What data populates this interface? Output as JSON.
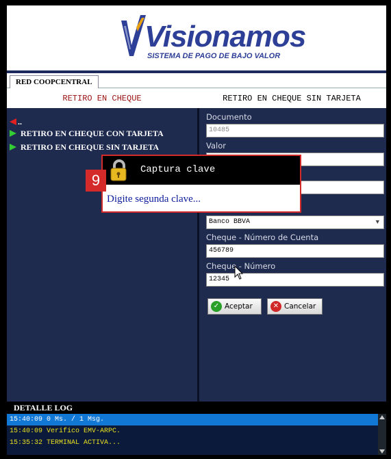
{
  "logo": {
    "brand": "Visionamos",
    "tagline": "SISTEMA DE PAGO DE BAJO VALOR"
  },
  "tab": {
    "label": "RED COOPCENTRAL"
  },
  "titles": {
    "left": "RETIRO EN CHEQUE",
    "right": "RETIRO EN CHEQUE SIN TARJETA"
  },
  "menu": {
    "back_label": "..",
    "items": [
      {
        "label": "RETIRO EN CHEQUE CON TARJETA"
      },
      {
        "label": "RETIRO EN CHEQUE SIN TARJETA"
      }
    ]
  },
  "form": {
    "documento_label": "Documento",
    "documento_value": "10485",
    "valor_label": "Valor",
    "valor_value": "",
    "field3_value": "",
    "bank_value": "Banco BBVA",
    "cuenta_label": "Cheque - Número de Cuenta",
    "cuenta_value": "456789",
    "numero_label": "Cheque - Número",
    "numero_value": "12345",
    "accept_label": "Aceptar",
    "cancel_label": "Cancelar"
  },
  "log": {
    "header": "DETALLE LOG",
    "lines": [
      "15:40:09 0 Ms. / 1 Msg.",
      "15:40:09 Verifico EMV-ARPC.",
      "15:35:32 TERMINAL ACTIVA..."
    ]
  },
  "dialog": {
    "title": "Captura clave",
    "message": "Digite segunda  clave..."
  },
  "badge": {
    "number": "9"
  },
  "colors": {
    "brand_blue": "#2d3f96",
    "panel": "#1e2a4e",
    "alert_red": "#d42a2a",
    "log_yellow": "#e8e020",
    "selection": "#1278d6"
  },
  "icons": {
    "back": "red-left-arrow-icon",
    "menu_bullet": "green-arrow-icon",
    "dialog": "lock-icon",
    "accept": "check-icon",
    "cancel": "x-icon"
  }
}
